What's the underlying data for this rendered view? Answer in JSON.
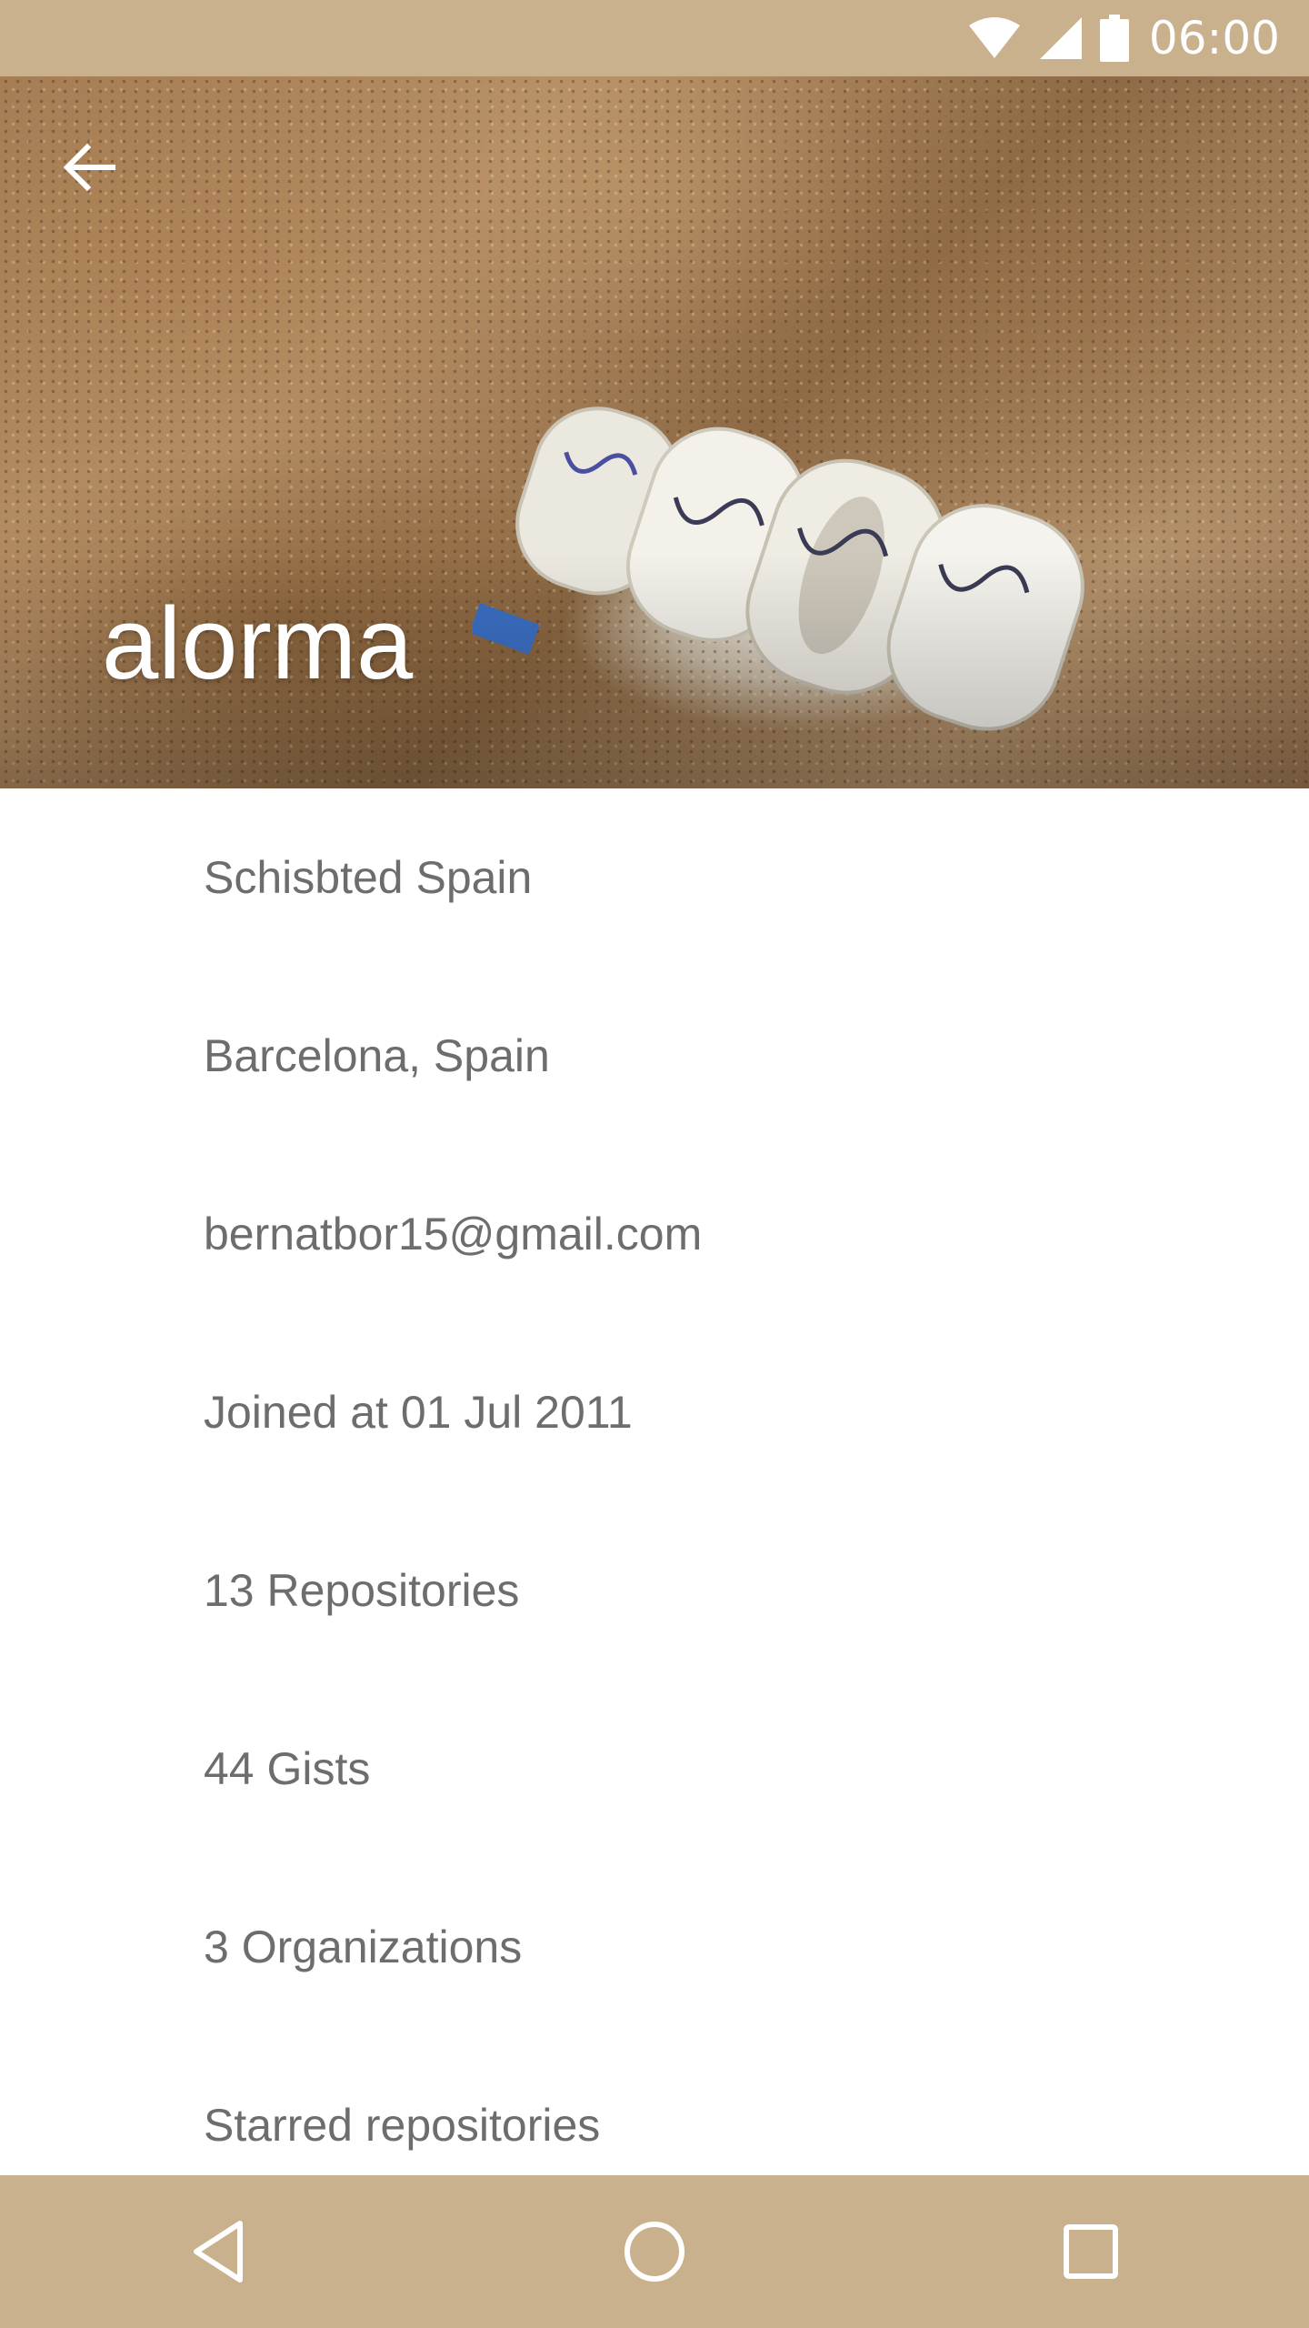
{
  "status_bar": {
    "time": "06:00",
    "icons": [
      "wifi-icon",
      "cellular-signal-icon",
      "battery-icon"
    ]
  },
  "header": {
    "profile_name": "alorma",
    "back_icon": "arrow-back-icon",
    "background_color": "#c8b18c"
  },
  "details": [
    {
      "label": "Schisbted Spain"
    },
    {
      "label": "Barcelona, Spain"
    },
    {
      "label": "bernatbor15@gmail.com"
    },
    {
      "label": "Joined at 01 Jul 2011"
    },
    {
      "label": "13 Repositories"
    },
    {
      "label": "44 Gists"
    },
    {
      "label": "3 Organizations"
    },
    {
      "label": "Starred repositories"
    }
  ],
  "nav_bar": {
    "buttons": [
      "back-triangle-icon",
      "home-circle-icon",
      "recents-square-icon"
    ]
  }
}
